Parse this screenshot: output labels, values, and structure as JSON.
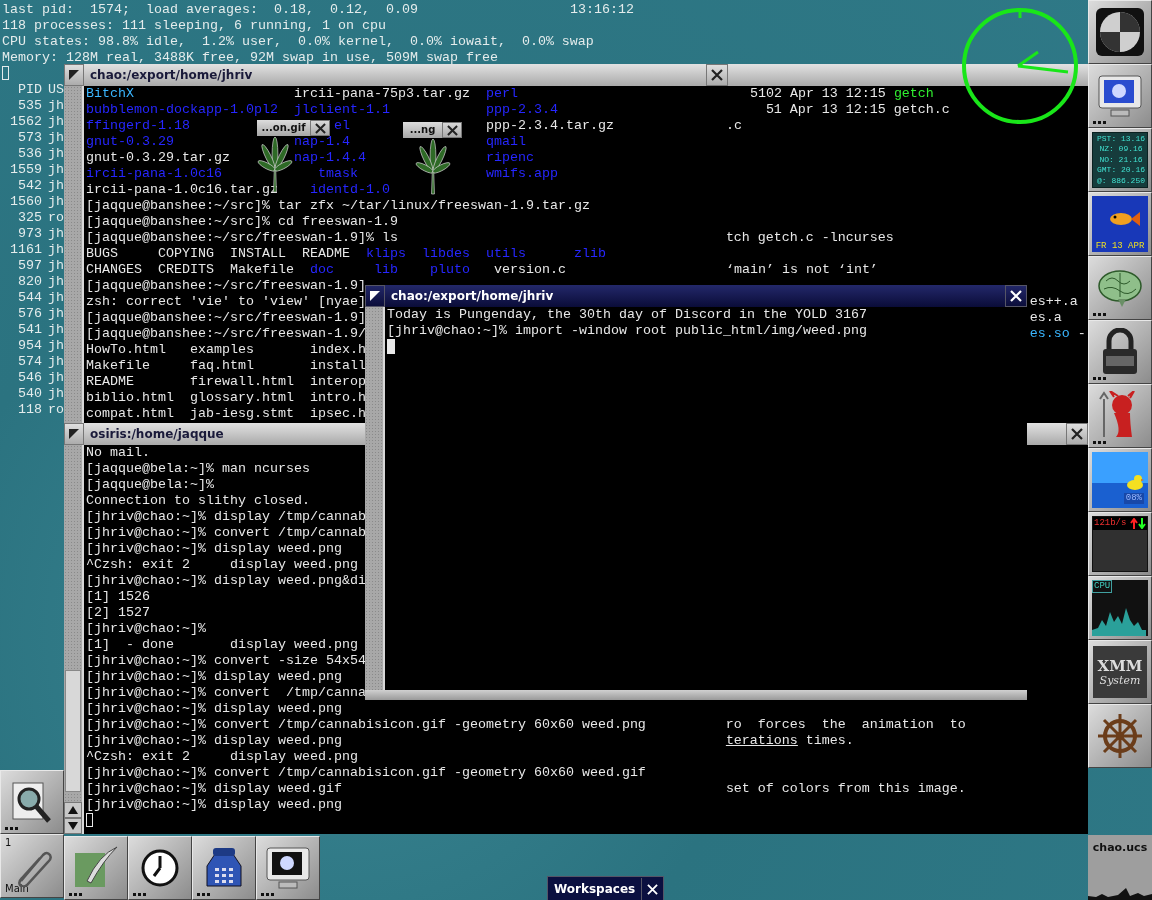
{
  "desktop_status": {
    "lines": [
      "last pid:  1574;  load averages:  0.18,  0.12,  0.09",
      "118 processes: 111 sleeping, 6 running, 1 on cpu",
      "CPU states: 98.8% idle,  1.2% user,  0.0% kernel,  0.0% iowait,  0.0% swap",
      "Memory: 128M real, 3488K free, 92M swap in use, 509M swap free"
    ],
    "time": "13:16:12",
    "process_header": {
      "pid": "PID",
      "user": "US"
    },
    "process_rows": [
      {
        "pid": "535",
        "user": "jh"
      },
      {
        "pid": "1562",
        "user": "jh"
      },
      {
        "pid": "573",
        "user": "jh"
      },
      {
        "pid": "536",
        "user": "jh"
      },
      {
        "pid": "1559",
        "user": "jh"
      },
      {
        "pid": "542",
        "user": "jh"
      },
      {
        "pid": "1560",
        "user": "jh"
      },
      {
        "pid": "325",
        "user": "ro"
      },
      {
        "pid": "973",
        "user": "jh"
      },
      {
        "pid": "1161",
        "user": "jh"
      },
      {
        "pid": "597",
        "user": "jh"
      },
      {
        "pid": "820",
        "user": "jh"
      },
      {
        "pid": "544",
        "user": "jh"
      },
      {
        "pid": "576",
        "user": "jh"
      },
      {
        "pid": "541",
        "user": "jh"
      },
      {
        "pid": "954",
        "user": "jh"
      },
      {
        "pid": "574",
        "user": "jh"
      },
      {
        "pid": "546",
        "user": "jh"
      },
      {
        "pid": "540",
        "user": "jh"
      },
      {
        "pid": "118",
        "user": "ro"
      }
    ]
  },
  "back_terminal": {
    "title": "chao:/export/home/jhriv",
    "active": false,
    "lines": [
      {
        "segments": [
          {
            "text": "BitchX",
            "kind": "link"
          },
          {
            "text": "                    ircii-pana-75p3.tar.gz",
            "kind": "plain"
          },
          {
            "text": "  perl",
            "kind": "dir"
          },
          {
            "text": "                             5102 Apr 13 12:15",
            "kind": "plain"
          },
          {
            "text": " getch",
            "kind": "exec"
          }
        ]
      },
      {
        "segments": [
          {
            "text": "bubblemon-dockapp-1.0pl2",
            "kind": "dir"
          },
          {
            "text": "  jlclient-1.1",
            "kind": "dir"
          },
          {
            "text": "            ppp-2.3.4",
            "kind": "dir"
          },
          {
            "text": "                          51 Apr 13 12:15 getch.c",
            "kind": "plain"
          }
        ]
      },
      {
        "segments": [
          {
            "text": "ffingerd-1.18",
            "kind": "dir"
          },
          {
            "text": "                  el",
            "kind": "dir"
          },
          {
            "text": "                 ppp-2.3.4.tar.gz",
            "kind": "plain"
          },
          {
            "text": "              .c",
            "kind": "plain"
          }
        ]
      },
      {
        "segments": [
          {
            "text": "gnut-0.3.29",
            "kind": "dir"
          },
          {
            "text": "               nap-1.4",
            "kind": "dir"
          },
          {
            "text": "                 qmail",
            "kind": "dir"
          }
        ]
      },
      {
        "segments": [
          {
            "text": "gnut-0.3.29.tar.gz",
            "kind": "plain"
          },
          {
            "text": "        nap-1.4.4",
            "kind": "dir"
          },
          {
            "text": "               ripenc",
            "kind": "dir"
          }
        ]
      },
      {
        "segments": [
          {
            "text": "ircii-pana-1.0c16",
            "kind": "dir"
          },
          {
            "text": "            tmask",
            "kind": "dir"
          },
          {
            "text": "                wmifs.app",
            "kind": "dir"
          }
        ]
      },
      {
        "segments": [
          {
            "text": "ircii-pana-1.0c16.tar.gz",
            "kind": "plain"
          },
          {
            "text": "    identd-1.0",
            "kind": "dir"
          }
        ]
      },
      {
        "segments": [
          {
            "text": "[jaqque@banshee:~/src]% tar zfx ~/tar/linux/freeswan-1.9.tar.gz",
            "kind": "plain"
          }
        ]
      },
      {
        "segments": [
          {
            "text": "[jaqque@banshee:~/src]% cd freeswan-1.9",
            "kind": "plain"
          }
        ]
      },
      {
        "segments": [
          {
            "text": "[jaqque@banshee:~/src/freeswan-1.9]% ls",
            "kind": "plain"
          },
          {
            "text": "                                         tch getch.c -lncurses",
            "kind": "plain"
          }
        ]
      },
      {
        "segments": [
          {
            "text": "BUGS     COPYING  INSTALL  README",
            "kind": "plain"
          },
          {
            "text": "  klips",
            "kind": "dir"
          },
          {
            "text": "  libdes",
            "kind": "dir"
          },
          {
            "text": "  utils",
            "kind": "dir"
          },
          {
            "text": "      zlib",
            "kind": "dir"
          }
        ]
      },
      {
        "segments": [
          {
            "text": "CHANGES  CREDITS  Makefile",
            "kind": "plain"
          },
          {
            "text": "  doc",
            "kind": "dir"
          },
          {
            "text": "     lib",
            "kind": "dir"
          },
          {
            "text": "    pluto",
            "kind": "dir"
          },
          {
            "text": "   version.c",
            "kind": "plain"
          },
          {
            "text": "                    ‘main’ is not ‘int’",
            "kind": "plain"
          }
        ]
      },
      {
        "segments": [
          {
            "text": "[jaqque@banshee:~/src/freeswan-1.9]",
            "kind": "plain"
          }
        ]
      },
      {
        "segments": [
          {
            "text": "zsh: correct 'vie' to 'view' [nyae]",
            "kind": "plain"
          },
          {
            "text": "                                                                                   es++.a",
            "kind": "plain"
          }
        ]
      },
      {
        "segments": [
          {
            "text": "[jaqque@banshee:~/src/freeswan-1.9]",
            "kind": "plain"
          },
          {
            "text": "                                                                                   es.a",
            "kind": "plain"
          }
        ]
      },
      {
        "segments": [
          {
            "text": "[jaqque@banshee:~/src/freeswan-1.9/",
            "kind": "plain"
          },
          {
            "text": "                                                                                   es.so",
            "kind": "link"
          },
          {
            "text": " -",
            "kind": "plain"
          }
        ]
      },
      {
        "segments": [
          {
            "text": "HowTo.html   examples       index.h",
            "kind": "plain"
          }
        ]
      },
      {
        "segments": [
          {
            "text": "Makefile     faq.html       install",
            "kind": "plain"
          }
        ]
      },
      {
        "segments": [
          {
            "text": "README       firewall.html  interop",
            "kind": "plain"
          }
        ]
      },
      {
        "segments": [
          {
            "text": "biblio.html  glossary.html  intro.h",
            "kind": "plain"
          }
        ]
      },
      {
        "segments": [
          {
            "text": "compat.html  jab-iesg.stmt  ipsec.h",
            "kind": "plain"
          }
        ]
      }
    ]
  },
  "image_popups": [
    {
      "title": "...on.gif"
    },
    {
      "title": "...ng"
    }
  ],
  "lower_terminal": {
    "title": "osiris:/home/jaqque",
    "active": false,
    "lines": [
      {
        "segments": [
          {
            "text": "No mail.",
            "kind": "plain"
          }
        ]
      },
      {
        "segments": [
          {
            "text": "[jaqque@bela:~]% man ncurses",
            "kind": "plain"
          }
        ]
      },
      {
        "segments": [
          {
            "text": "[jaqque@bela:~]%",
            "kind": "plain"
          }
        ]
      },
      {
        "segments": [
          {
            "text": "Connection to slithy closed.",
            "kind": "plain"
          }
        ]
      },
      {
        "segments": [
          {
            "text": "[jhriv@chao:~]% display /tmp/cannab",
            "kind": "plain"
          }
        ]
      },
      {
        "segments": [
          {
            "text": "[jhriv@chao:~]% convert /tmp/cannab",
            "kind": "plain"
          }
        ]
      },
      {
        "segments": [
          {
            "text": "[jhriv@chao:~]% display weed.png",
            "kind": "plain"
          }
        ]
      },
      {
        "segments": [
          {
            "text": "^Czsh: exit 2     display weed.png",
            "kind": "plain"
          }
        ]
      },
      {
        "segments": [
          {
            "text": "[jhriv@chao:~]% display weed.png&di",
            "kind": "plain"
          }
        ]
      },
      {
        "segments": [
          {
            "text": "[1] 1526",
            "kind": "plain"
          }
        ]
      },
      {
        "segments": [
          {
            "text": "[2] 1527",
            "kind": "plain"
          }
        ]
      },
      {
        "segments": [
          {
            "text": "[jhriv@chao:~]%",
            "kind": "plain"
          }
        ]
      },
      {
        "segments": [
          {
            "text": "[1]  - done       display weed.png",
            "kind": "plain"
          }
        ]
      },
      {
        "segments": [
          {
            "text": "[jhriv@chao:~]% convert -size 54x54",
            "kind": "plain"
          }
        ]
      },
      {
        "segments": [
          {
            "text": "[jhriv@chao:~]% display weed.png",
            "kind": "plain"
          }
        ]
      },
      {
        "segments": [
          {
            "text": "[jhriv@chao:~]% convert  /tmp/canna",
            "kind": "plain"
          }
        ]
      },
      {
        "segments": [
          {
            "text": "[jhriv@chao:~]% display weed.png",
            "kind": "plain"
          }
        ]
      },
      {
        "segments": [
          {
            "text": "[jhriv@chao:~]% convert /tmp/cannabisicon.gif -geometry 60x60 weed.png",
            "kind": "plain"
          },
          {
            "text": "          ro  forces  the  animation  to",
            "kind": "plain"
          }
        ]
      },
      {
        "segments": [
          {
            "text": "[jhriv@chao:~]% display weed.png",
            "kind": "plain"
          },
          {
            "text": "                                                terations",
            "kind": "underline"
          },
          {
            "text": " times.",
            "kind": "plain"
          }
        ]
      },
      {
        "segments": [
          {
            "text": "^Czsh: exit 2     display weed.png",
            "kind": "plain"
          }
        ]
      },
      {
        "segments": [
          {
            "text": "[jhriv@chao:~]% convert /tmp/cannabisicon.gif -geometry 60x60 weed.gif",
            "kind": "plain"
          }
        ]
      },
      {
        "segments": [
          {
            "text": "[jhriv@chao:~]% display weed.gif",
            "kind": "plain"
          },
          {
            "text": "                                                set of colors from this image.",
            "kind": "plain"
          }
        ]
      },
      {
        "segments": [
          {
            "text": "[jhriv@chao:~]% display weed.png",
            "kind": "plain"
          }
        ]
      }
    ]
  },
  "front_terminal": {
    "title": "chao:/export/home/jhriv",
    "active": true,
    "lines": [
      {
        "segments": [
          {
            "text": "Today is Pungenday, the 30th day of Discord in the YOLD 3167",
            "kind": "plain"
          }
        ]
      },
      {
        "segments": [
          {
            "text": "[jhriv@chao:~]% import -window root public_html/img/weed.png",
            "kind": "plain"
          }
        ]
      }
    ]
  },
  "dock": [
    {
      "kind": "logo",
      "dots": false
    },
    {
      "kind": "monitor",
      "dots": true
    },
    {
      "kind": "zones",
      "dots": false,
      "lines": [
        "PST: 13.16",
        "NZ: 09.16",
        "NO: 21.16",
        "GMT: 20.16",
        "@: 886.250"
      ]
    },
    {
      "kind": "aquarium",
      "dots": false,
      "text": "FR 13 APR"
    },
    {
      "kind": "brain",
      "dots": true
    },
    {
      "kind": "lock",
      "dots": true
    },
    {
      "kind": "daemon",
      "dots": true
    },
    {
      "kind": "duck",
      "dots": false,
      "text": "08%"
    },
    {
      "kind": "network",
      "dots": false,
      "text": "121b/s"
    },
    {
      "kind": "cpu",
      "dots": false,
      "text": "CPU"
    },
    {
      "kind": "xmm",
      "dots": false,
      "lines": [
        "XMM",
        "System"
      ]
    },
    {
      "kind": "wheel",
      "dots": false
    }
  ],
  "side_tile": {
    "kind": "magnifier",
    "dots": true
  },
  "clip": {
    "number": "1",
    "label": "Main"
  },
  "bottom_icons": [
    {
      "kind": "quill",
      "dots": true
    },
    {
      "kind": "clock",
      "dots": true
    },
    {
      "kind": "phone",
      "dots": true
    },
    {
      "kind": "terminal",
      "dots": true
    }
  ],
  "workspaces": {
    "label": "Workspaces"
  },
  "host": {
    "label": "chao.ucs"
  }
}
